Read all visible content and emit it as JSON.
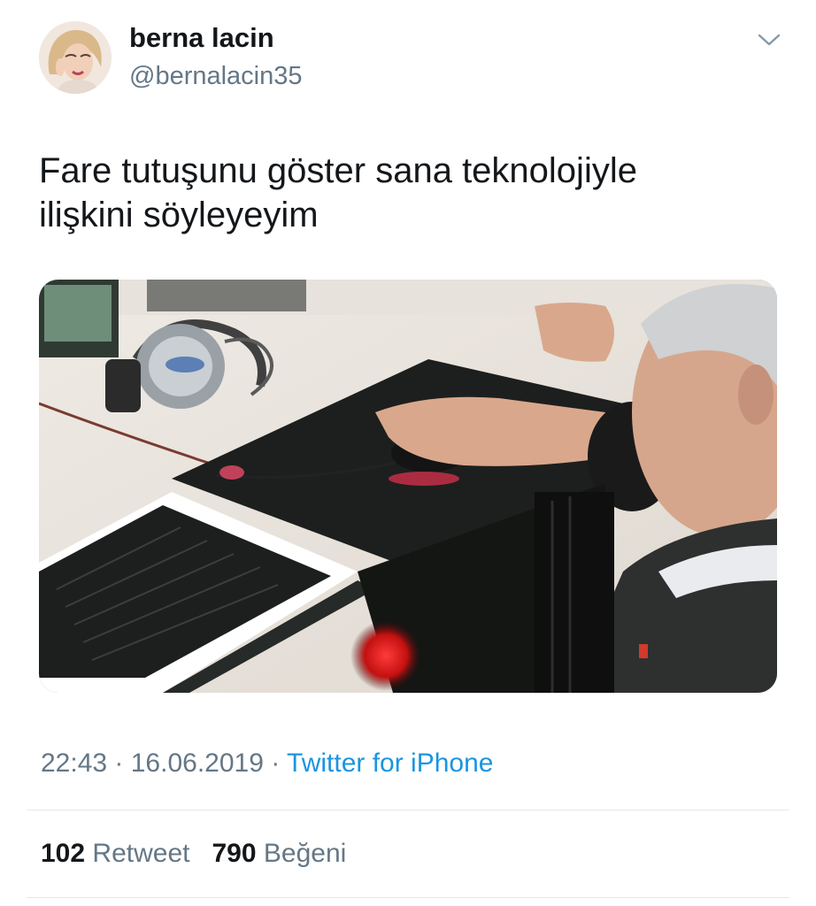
{
  "author": {
    "display_name": "berna lacin",
    "handle": "@bernalacin35"
  },
  "header": {
    "menu_icon": "chevron-down-icon"
  },
  "tweet": {
    "text_lines": [
      "Fare tutuşunu göster sana teknolojiyle",
      "ilişkini söyleyeyim"
    ]
  },
  "meta": {
    "time": "22:43",
    "separator_1": " · ",
    "date": "16.06.2019",
    "separator_2": " · ",
    "source": "Twitter for iPhone"
  },
  "stats": {
    "retweet_count": "102",
    "retweet_label": "Retweet",
    "like_count": "790",
    "like_label": "Beğeni"
  },
  "colors": {
    "link": "#1b95e0",
    "secondary_text": "#657786",
    "primary_text": "#14171a",
    "divider": "#e1e8ed"
  }
}
